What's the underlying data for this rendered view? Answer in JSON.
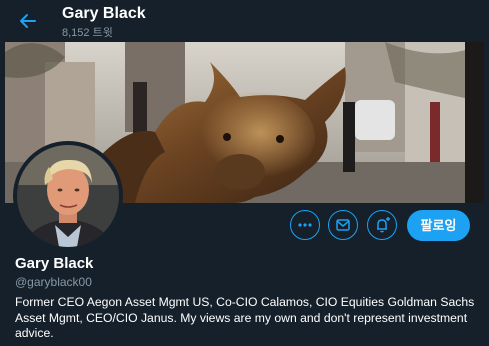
{
  "header": {
    "title": "Gary Black",
    "tweet_count": "8,152 트윗",
    "back_icon": "arrow-left-icon"
  },
  "profile": {
    "name": "Gary Black",
    "handle": "@garyblack00",
    "bio": "Former CEO Aegon Asset Mgmt US, Co-CIO Calamos, CIO Equities Goldman Sachs Asset Mgmt, CEO/CIO Janus. My views are my own and don't represent investment advice."
  },
  "actions": {
    "more_icon": "more-icon",
    "message_icon": "mail-icon",
    "notify_icon": "bell-plus-icon",
    "follow_label": "팔로잉"
  },
  "colors": {
    "background": "#15202b",
    "accent": "#1da1f2",
    "secondary_text": "#8899a6"
  }
}
